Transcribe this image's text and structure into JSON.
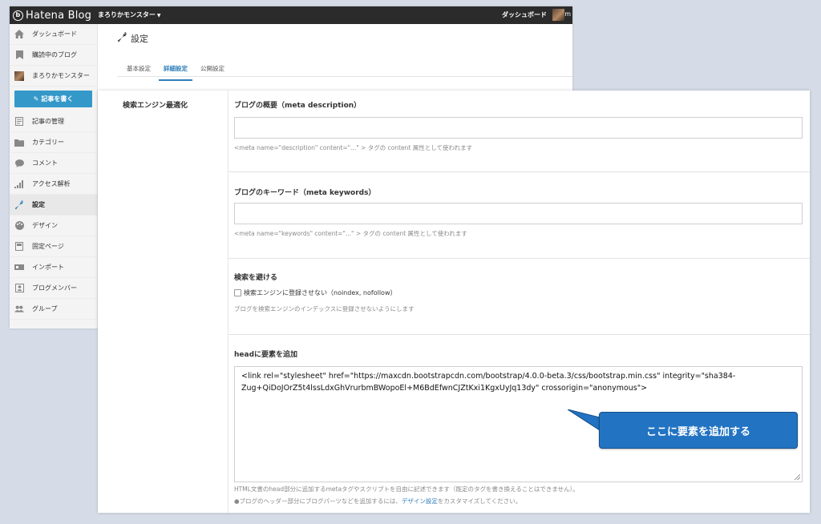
{
  "topbar": {
    "logo_text": "Hatena Blog",
    "blog_name": "まろりかモンスター",
    "dashboard_label": "ダッシュボード",
    "user_initial": "m"
  },
  "sidebar": {
    "items": [
      {
        "label": "ダッシュボード",
        "icon": "home-icon"
      },
      {
        "label": "購読中のブログ",
        "icon": "bookmark-icon"
      },
      {
        "label": "まろりかモンスター",
        "icon": "avatar"
      },
      {
        "label": "記事を書く",
        "icon": "pen-icon"
      },
      {
        "label": "記事の管理",
        "icon": "document-icon"
      },
      {
        "label": "カテゴリー",
        "icon": "folder-icon"
      },
      {
        "label": "コメント",
        "icon": "comment-icon"
      },
      {
        "label": "アクセス解析",
        "icon": "bar-chart-icon"
      },
      {
        "label": "設定",
        "icon": "wrench-icon"
      },
      {
        "label": "デザイン",
        "icon": "palette-icon"
      },
      {
        "label": "固定ページ",
        "icon": "page-icon"
      },
      {
        "label": "インポート",
        "icon": "import-icon"
      },
      {
        "label": "ブログメンバー",
        "icon": "members-icon"
      },
      {
        "label": "グループ",
        "icon": "group-icon"
      }
    ],
    "active": "設定"
  },
  "settings": {
    "title": "設定",
    "tabs": [
      {
        "label": "基本設定",
        "active": false
      },
      {
        "label": "詳細設定",
        "active": true
      },
      {
        "label": "公開設定",
        "active": false
      }
    ]
  },
  "seo": {
    "section_title": "検索エンジン最適化",
    "meta_description": {
      "label": "ブログの概要（meta description）",
      "value": "",
      "hint": "<meta name=\"description\" content=\"...\" > タグの content 属性として使われます"
    },
    "meta_keywords": {
      "label": "ブログのキーワード（meta keywords）",
      "value": "",
      "hint": "<meta name=\"keywords\" content=\"...\" > タグの content 属性として使われます"
    },
    "noindex": {
      "label": "検索を避ける",
      "checkbox_label": "検索エンジンに登録させない（noindex, nofollow）",
      "checked": false,
      "hint": "ブログを検索エンジンのインデックスに登録させないようにします"
    },
    "head_elements": {
      "label": "headに要素を追加",
      "value": "<link rel=\"stylesheet\" href=\"https://maxcdn.bootstrapcdn.com/bootstrap/4.0.0-beta.3/css/bootstrap.min.css\" integrity=\"sha384-Zug+QiDoJOrZ5t4lssLdxGhVrurbmBWopoEl+M6BdEfwnCJZtKxi1KgxUyJq13dy\" crossorigin=\"anonymous\">",
      "hint1": "HTML文書のhead部分に追加するmetaタグやスクリプトを自由に記述できます（既定のタグを書き換えることはできません）。",
      "hint2_prefix": "●ブログのヘッダー部分にブログパーツなどを追加するには、",
      "hint2_link": "デザイン設定",
      "hint2_suffix": "をカスタマイズしてください。"
    }
  },
  "callout": {
    "text": "ここに要素を追加する"
  },
  "colors": {
    "accent": "#2f7fb8",
    "write_button": "#3498c9",
    "callout": "#2273c2",
    "topbar": "#2b2b2b"
  }
}
